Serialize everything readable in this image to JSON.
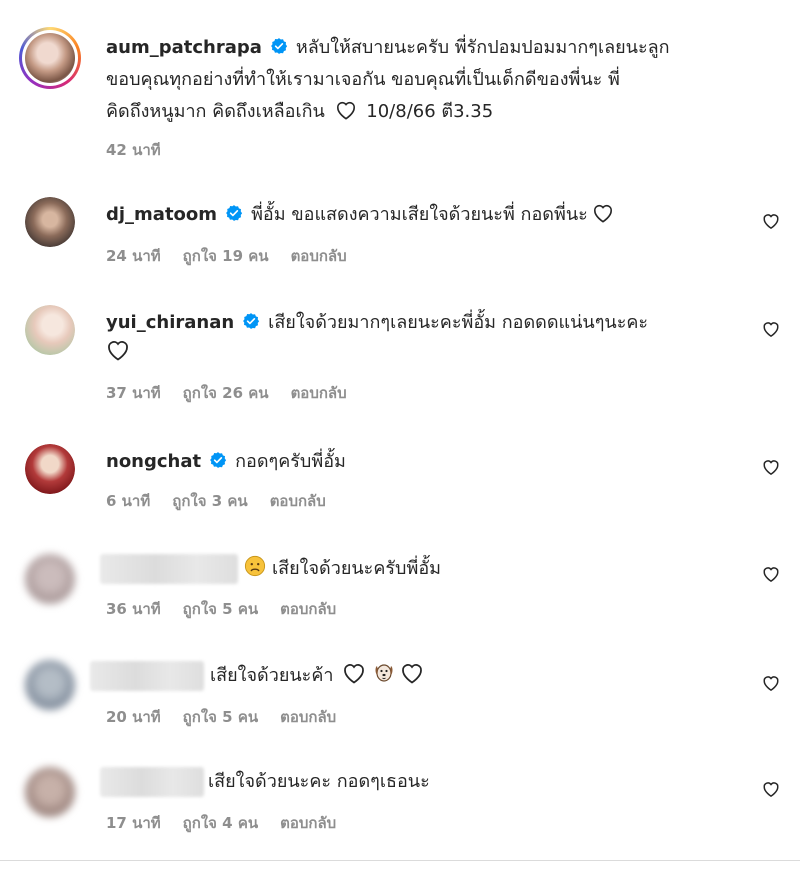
{
  "caption": {
    "username": "aum_patchrapa",
    "verified": true,
    "text_line1": "หลับให้สบายนะครับ พี่รักปอมปอมมากๆเลยนะลูก",
    "text_line2": "ขอบคุณทุกอย่างที่ทำให้เรามาเจอกัน ขอบคุณที่เป็นเด็กดีของพี่นะ พี่",
    "text_line3": "คิดถึงหนูมาก คิดถึงเหลือเกิน",
    "text_line3_after_heart": "10/8/66 ตี3.35",
    "time": "42 นาที"
  },
  "comments": [
    {
      "username": "dj_matoom",
      "verified": true,
      "text_line1": "พี่อั้ม ขอแสดงความเสียใจด้วยนะพี่ กอดพี่นะ",
      "time": "24 นาที",
      "likes": "ถูกใจ 19 คน",
      "reply": "ตอบกลับ",
      "avatar_color": "#5a4a42"
    },
    {
      "username": "yui_chiranan",
      "verified": true,
      "text_line1": "เสียใจด้วยมากๆเลยนะคะพี่อั้ม กอดดดแน่นๆนะคะ",
      "time": "37 นาที",
      "likes": "ถูกใจ 26 คน",
      "reply": "ตอบกลับ",
      "avatar_color": "#e9d8cf"
    },
    {
      "username": "nongchat",
      "verified": true,
      "text_line1": "กอดๆครับพี่อั้ม",
      "time": "6 นาที",
      "likes": "ถูกใจ 3 คน",
      "reply": "ตอบกลับ",
      "avatar_color": "#a8232a"
    },
    {
      "username": "",
      "verified": false,
      "text_line1": "เสียใจด้วยนะครับพี่อั้ม",
      "time": "36 นาที",
      "likes": "ถูกใจ 5 คน",
      "reply": "ตอบกลับ",
      "avatar_color": "#b9b0b0"
    },
    {
      "username": "",
      "verified": false,
      "text_line1": "เสียใจด้วยนะค้า",
      "time": "20 นาที",
      "likes": "ถูกใจ 5 คน",
      "reply": "ตอบกลับ",
      "avatar_color": "#8e9aa8"
    },
    {
      "username": "",
      "verified": false,
      "text_line1": "เสียใจด้วยนะคะ กอดๆเธอนะ",
      "time": "17 นาที",
      "likes": "ถูกใจ 4 คน",
      "reply": "ตอบกลับ",
      "avatar_color": "#a9958f"
    }
  ],
  "icons": {
    "verified": "verified-badge-icon",
    "like": "heart-outline-icon",
    "sad_emoji": "sad-face-emoji",
    "dog_emoji": "dog-face-emoji"
  },
  "colors": {
    "verified_blue": "#0095f6",
    "meta_gray": "#8e8e8e",
    "text": "#262626"
  }
}
